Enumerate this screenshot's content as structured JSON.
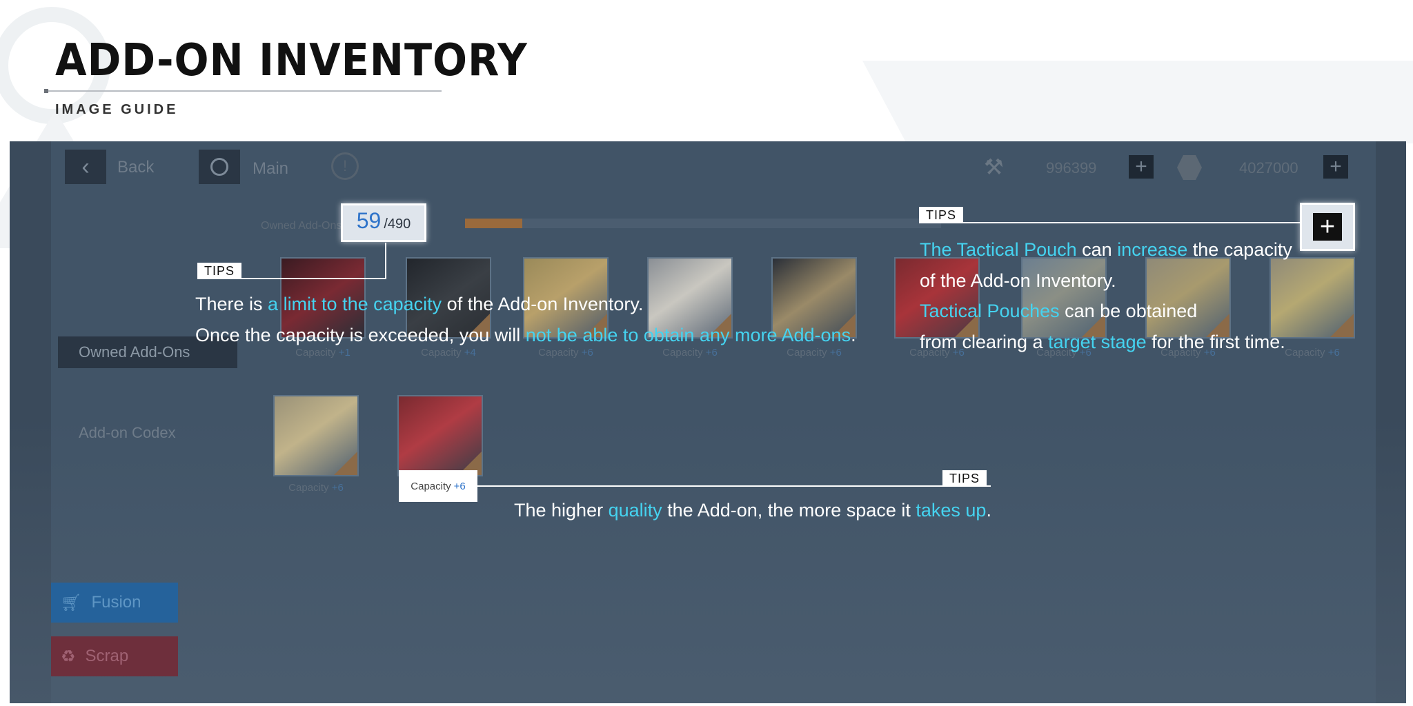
{
  "header": {
    "title": "ADD-ON INVENTORY",
    "subtitle": "IMAGE GUIDE"
  },
  "topbar": {
    "back_label": "Back",
    "main_label": "Main",
    "currency_1": "996399",
    "currency_2": "4027000"
  },
  "inventory": {
    "owned_label": "Owned Add-Ons",
    "current": "59",
    "max": "/490",
    "fill_fraction": 0.12
  },
  "sidebar": {
    "owned_tab": "Owned Add-Ons",
    "codex_tab": "Add-on Codex"
  },
  "cards": [
    {
      "label": "Capacity",
      "value": "+1"
    },
    {
      "label": "Capacity",
      "value": "+4"
    },
    {
      "label": "Capacity",
      "value": "+6"
    },
    {
      "label": "Capacity",
      "value": "+6"
    },
    {
      "label": "Capacity",
      "value": "+6"
    },
    {
      "label": "Capacity",
      "value": "+6"
    },
    {
      "label": "Capacity",
      "value": "+6"
    },
    {
      "label": "Capacity",
      "value": "+6"
    },
    {
      "label": "Capacity",
      "value": "+6"
    },
    {
      "label": "Capacity",
      "value": "+6"
    }
  ],
  "actions": {
    "fusion": "Fusion",
    "scrap": "Scrap"
  },
  "tips": {
    "tag": "TIPS",
    "tip1": {
      "l1a": "There is ",
      "l1b": "a limit to the capacity",
      "l1c": " of the Add-on Inventory.",
      "l2a": "Once the capacity is exceeded, you will ",
      "l2b": "not be able to obtain any more Add-ons",
      "l2c": "."
    },
    "tip2": {
      "l1a": "The Tactical Pouch",
      "l1b": " can ",
      "l1c": "increase",
      "l1d": " the capacity",
      "l2": "of the Add-on Inventory.",
      "l3a": "Tactical Pouches",
      "l3b": " can be obtained",
      "l4a": "from clearing a ",
      "l4b": "target stage",
      "l4c": " for the first time."
    },
    "tip3": {
      "a": "The higher ",
      "b": "quality",
      "c": " the Add-on, the more space it ",
      "d": "takes up",
      "e": "."
    },
    "highlight_capacity": {
      "label": "Capacity",
      "value": "+6"
    }
  },
  "colors": {
    "highlight": "#45d3f0",
    "panel": "#415467",
    "fusion": "#25629b",
    "scrap": "#6e2f3c"
  }
}
